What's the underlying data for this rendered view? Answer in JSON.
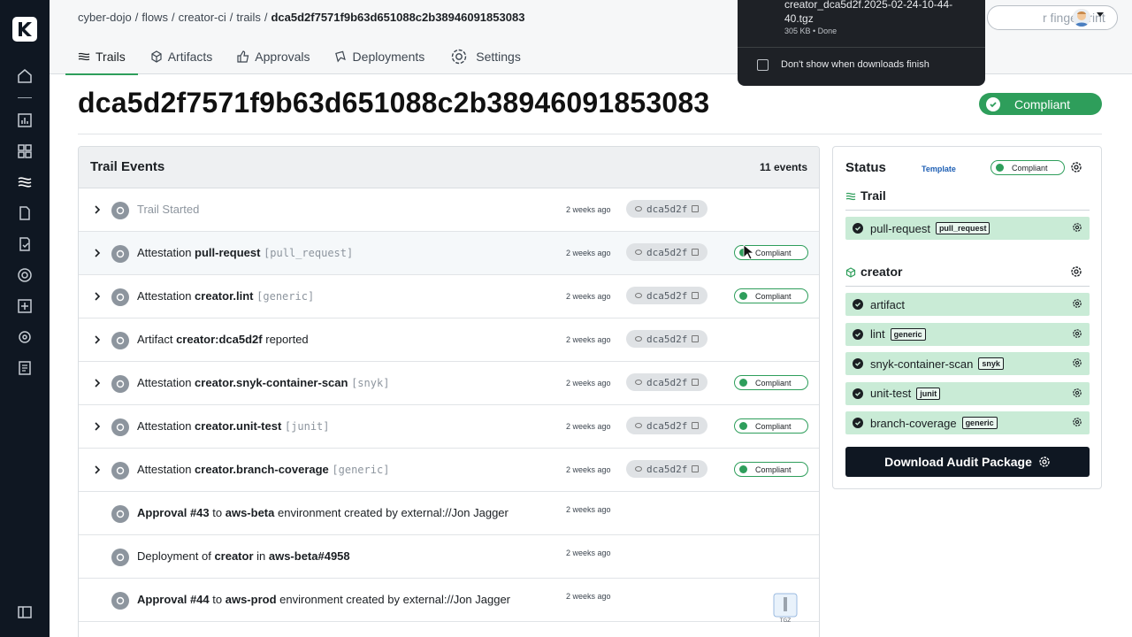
{
  "app": {
    "name": "Kosli"
  },
  "breadcrumb": {
    "items": [
      "cyber-dojo",
      "flows",
      "creator-ci",
      "trails"
    ],
    "current": "dca5d2f7571f9b63d651088c2b38946091853083"
  },
  "tabs": [
    {
      "label": "Trails",
      "icon": "trails-icon",
      "active": true
    },
    {
      "label": "Artifacts",
      "icon": "cube-icon",
      "active": false
    },
    {
      "label": "Approvals",
      "icon": "thumbs-up-icon",
      "active": false
    },
    {
      "label": "Deployments",
      "icon": "ship-icon",
      "active": false
    },
    {
      "label": "Settings",
      "icon": "gear-icon",
      "active": false
    }
  ],
  "search": {
    "visible_text": "r fingerprint"
  },
  "page": {
    "title": "dca5d2f7571f9b63d651088c2b38946091853083",
    "status": "Compliant"
  },
  "events": {
    "title": "Trail Events",
    "count": "11 events",
    "rows": [
      {
        "pre": "",
        "bold": "",
        "mid": "",
        "mono": "",
        "plain": "Trail Started",
        "ago": "2 weeks ago",
        "sha": "dca5d2f",
        "badge": ""
      },
      {
        "pre": "Attestation ",
        "bold": "pull-request",
        "mono": "[pull_request]",
        "ago": "2 weeks ago",
        "sha": "dca5d2f",
        "badge": "Compliant"
      },
      {
        "pre": "Attestation ",
        "bold": "creator.lint",
        "mono": "[generic]",
        "ago": "2 weeks ago",
        "sha": "dca5d2f",
        "badge": "Compliant"
      },
      {
        "pre": "Artifact ",
        "bold": "creator:dca5d2f",
        "post": " reported",
        "ago": "2 weeks ago",
        "sha": "dca5d2f",
        "badge": ""
      },
      {
        "pre": "Attestation ",
        "bold": "creator.snyk-container-scan",
        "mono": "[snyk]",
        "ago": "2 weeks ago",
        "sha": "dca5d2f",
        "badge": "Compliant"
      },
      {
        "pre": "Attestation ",
        "bold": "creator.unit-test",
        "mono": "[junit]",
        "ago": "2 weeks ago",
        "sha": "dca5d2f",
        "badge": "Compliant"
      },
      {
        "pre": "Attestation ",
        "bold": "creator.branch-coverage",
        "mono": "[generic]",
        "ago": "2 weeks ago",
        "sha": "dca5d2f",
        "badge": "Compliant"
      },
      {
        "pre": "",
        "bold": "Approval #43",
        "mid": " to ",
        "bold2": "aws-beta",
        "post": " environment created by external://Jon Jagger",
        "ago": "2 weeks ago"
      },
      {
        "pre": "Deployment of ",
        "bold": "creator",
        "mid": " in ",
        "bold2": "aws-beta#4958",
        "post": "",
        "ago": "2 weeks ago"
      },
      {
        "pre": "",
        "bold": "Approval #44",
        "mid": " to ",
        "bold2": "aws-prod",
        "post": " environment created by external://Jon Jagger",
        "ago": "2 weeks ago"
      }
    ]
  },
  "status_panel": {
    "title": "Status",
    "template_link": "Template",
    "badge": "Compliant",
    "trail_section": "Trail",
    "trail_items": [
      {
        "label": "pull-request",
        "tag": "pull_request"
      }
    ],
    "creator_section": "creator",
    "creator_items": [
      {
        "label": "artifact",
        "tag": ""
      },
      {
        "label": "lint",
        "tag": "generic"
      },
      {
        "label": "snyk-container-scan",
        "tag": "snyk"
      },
      {
        "label": "unit-test",
        "tag": "junit"
      },
      {
        "label": "branch-coverage",
        "tag": "generic"
      }
    ],
    "download_label": "Download Audit Package"
  },
  "downloads": {
    "filename": "creator_dca5d2f.2025-02-24-10-44-40.tgz",
    "meta": "305 KB • Done",
    "dont_show_label": "Don't show when downloads finish"
  },
  "thumb": {
    "label": "TGZ"
  },
  "colors": {
    "accent_green": "#2e9e5b",
    "rail_dark": "#0f1722",
    "status_row_bg": "#c9ebd6"
  }
}
